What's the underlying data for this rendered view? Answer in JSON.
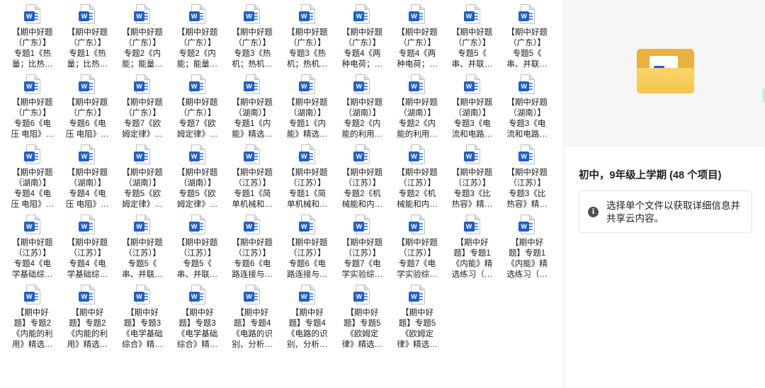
{
  "files": [
    {
      "name": "【期中好题\n（广东）】\n专题1《热\n量；比热…",
      "icon": "word-doc-icon"
    },
    {
      "name": "【期中好题\n（广东）】\n专题1《热\n量；比热…",
      "icon": "word-doc-icon"
    },
    {
      "name": "【期中好题\n（广东）】\n专题2《内\n能；能量…",
      "icon": "word-doc-icon"
    },
    {
      "name": "【期中好题\n（广东）】\n专题2《内\n能；能量…",
      "icon": "word-doc-icon"
    },
    {
      "name": "【期中好题\n（广东）】\n专题3《热\n机；热机…",
      "icon": "word-doc-icon"
    },
    {
      "name": "【期中好题\n（广东）】\n专题3《热\n机；热机…",
      "icon": "word-doc-icon"
    },
    {
      "name": "【期中好题\n（广东）】\n专题4《两\n种电荷；…",
      "icon": "word-doc-icon"
    },
    {
      "name": "【期中好题\n（广东）】\n专题4《两\n种电荷；…",
      "icon": "word-doc-icon"
    },
    {
      "name": "【期中好题\n（广东）】\n专题5《\n串、并联…",
      "icon": "word-doc-icon"
    },
    {
      "name": "【期中好题\n（广东）】\n专题5《\n串、并联…",
      "icon": "word-doc-icon"
    },
    {
      "name": "【期中好题\n（广东）】\n专题6《电\n压 电阻》…",
      "icon": "word-doc-icon"
    },
    {
      "name": "【期中好题\n（广东）】\n专题6《电\n压 电阻》…",
      "icon": "word-doc-icon"
    },
    {
      "name": "【期中好题\n（广东）】\n专题7《欧\n姆定律》…",
      "icon": "word-doc-icon"
    },
    {
      "name": "【期中好题\n（广东）】\n专题7《欧\n姆定律》…",
      "icon": "word-doc-icon"
    },
    {
      "name": "【期中好题\n（湖南）】\n专题1《内\n能》精选…",
      "icon": "word-doc-icon"
    },
    {
      "name": "【期中好题\n（湖南）】\n专题1《内\n能》精选…",
      "icon": "word-doc-icon"
    },
    {
      "name": "【期中好题\n（湖南）】\n专题2《内\n能的利用…",
      "icon": "word-doc-icon"
    },
    {
      "name": "【期中好题\n（湖南）】\n专题2《内\n能的利用…",
      "icon": "word-doc-icon"
    },
    {
      "name": "【期中好题\n（湖南）】\n专题3《电\n流和电路…",
      "icon": "word-doc-icon"
    },
    {
      "name": "【期中好题\n（湖南）】\n专题3《电\n流和电路…",
      "icon": "word-doc-icon"
    },
    {
      "name": "【期中好题\n（湖南）】\n专题4《电\n压 电阻》…",
      "icon": "word-doc-icon"
    },
    {
      "name": "【期中好题\n（湖南）】\n专题4《电\n压 电阻》…",
      "icon": "word-doc-icon"
    },
    {
      "name": "【期中好题\n（湖南）】\n专题5《欧\n姆定律》…",
      "icon": "word-doc-icon"
    },
    {
      "name": "【期中好题\n（湖南）】\n专题5《欧\n姆定律》…",
      "icon": "word-doc-icon"
    },
    {
      "name": "【期中好题\n（江苏）】\n专题1《简\n单机械和…",
      "icon": "word-doc-icon"
    },
    {
      "name": "【期中好题\n（江苏）】\n专题1《简\n单机械和…",
      "icon": "word-doc-icon"
    },
    {
      "name": "【期中好题\n（江苏）】\n专题2《机\n械能和内…",
      "icon": "word-doc-icon"
    },
    {
      "name": "【期中好题\n（江苏）】\n专题2《机\n械能和内…",
      "icon": "word-doc-icon"
    },
    {
      "name": "【期中好题\n（江苏）】\n专题3《比\n热容》精…",
      "icon": "word-doc-icon"
    },
    {
      "name": "【期中好题\n（江苏）】\n专题3《比\n热容》精…",
      "icon": "word-doc-icon"
    },
    {
      "name": "【期中好题\n（江苏）】\n专题4《电\n学基础综…",
      "icon": "word-doc-icon"
    },
    {
      "name": "【期中好题\n（江苏）】\n专题4《电\n学基础综…",
      "icon": "word-doc-icon"
    },
    {
      "name": "【期中好题\n（江苏）】\n专题5《\n串、并联…",
      "icon": "word-doc-icon"
    },
    {
      "name": "【期中好题\n（江苏）】\n专题5《\n串、并联…",
      "icon": "word-doc-icon"
    },
    {
      "name": "【期中好题\n（江苏）】\n专题6《电\n路连接与…",
      "icon": "word-doc-icon"
    },
    {
      "name": "【期中好题\n（江苏）】\n专题6《电\n路连接与…",
      "icon": "word-doc-icon"
    },
    {
      "name": "【期中好题\n（江苏）】\n专题7《电\n学实验综…",
      "icon": "word-doc-icon"
    },
    {
      "name": "【期中好题\n（江苏）】\n专题7《电\n学实验综…",
      "icon": "word-doc-icon"
    },
    {
      "name": "【期中好\n题】专题1\n《内能》精\n选练习（…",
      "icon": "word-doc-icon"
    },
    {
      "name": "【期中好\n题】专题1\n《内能》精\n选练习（…",
      "icon": "word-doc-icon"
    },
    {
      "name": "【期中好\n题】专题2\n《内能的利\n用》精选…",
      "icon": "word-doc-icon"
    },
    {
      "name": "【期中好\n题】专题2\n《内能的利\n用》精选…",
      "icon": "word-doc-icon"
    },
    {
      "name": "【期中好\n题】专题3\n《电学基础\n综合》精…",
      "icon": "word-doc-icon"
    },
    {
      "name": "【期中好\n题】专题3\n《电学基础\n综合》精…",
      "icon": "word-doc-icon"
    },
    {
      "name": "【期中好\n题】专题4\n《电路的识\n别、分析…",
      "icon": "word-doc-icon"
    },
    {
      "name": "【期中好\n题】专题4\n《电路的识\n别、分析…",
      "icon": "word-doc-icon"
    },
    {
      "name": "【期中好\n题】专题5\n《欧姆定\n律》精选…",
      "icon": "word-doc-icon"
    },
    {
      "name": "【期中好\n题】专题5\n《欧姆定\n律》精选…",
      "icon": "word-doc-icon"
    }
  ],
  "details": {
    "folder_title": "初中，9年级上学期 (48 个项目)",
    "info_text": "选择单个文件以获取详细信息并共享云内容。",
    "info_icon": "info-icon",
    "preview_icon": "folder-with-word-doc-icon",
    "word_badge_letter": "W"
  },
  "colors": {
    "word_blue": "#1e5fc7",
    "folder_yellow": "#f5c54c",
    "pane_preview_bg": "#f6f6f6"
  }
}
